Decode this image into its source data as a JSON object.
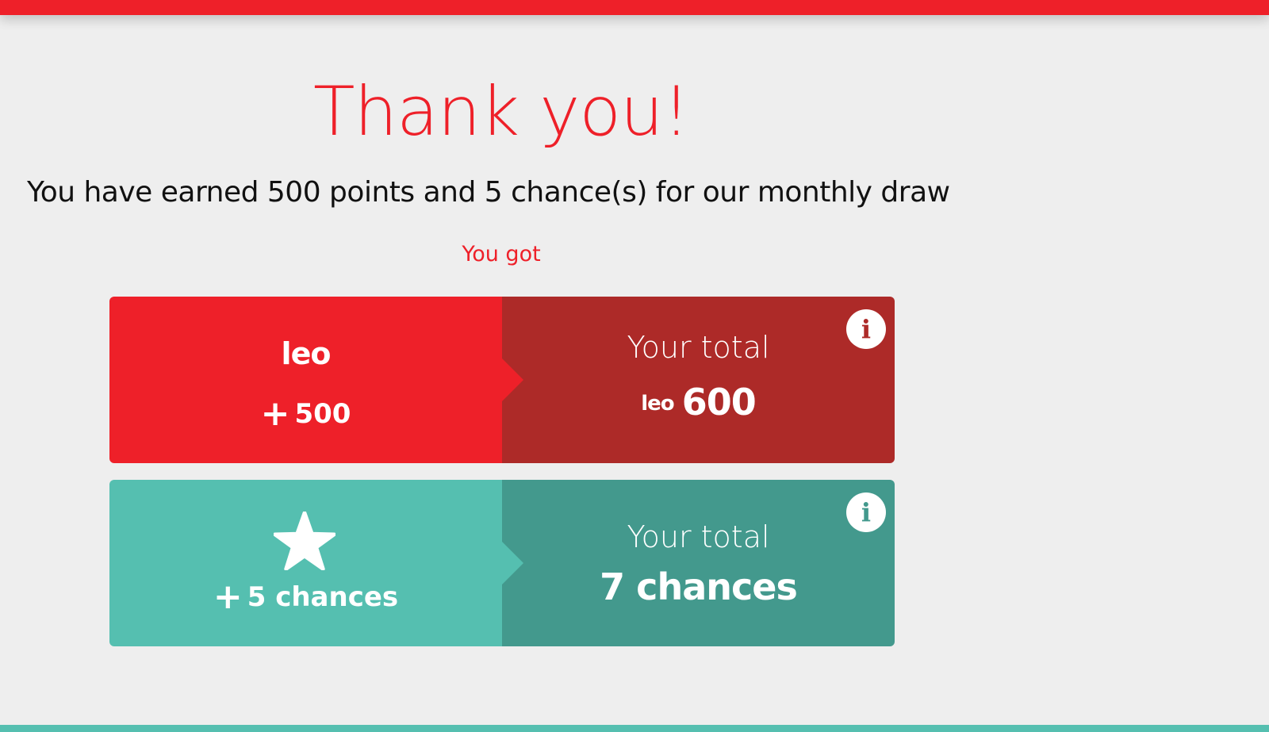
{
  "header": {
    "color": "#ee2029"
  },
  "title": "Thank you!",
  "subtitle": "You have earned 500 points and 5 chance(s) for our monthly draw",
  "you_got_label": "You got",
  "points_card": {
    "brand_logo": "leo",
    "plus_symbol": "+",
    "earned_points": "500",
    "total_label": "Your total",
    "total_logo": "leo",
    "total_points": "600",
    "info_icon": "i",
    "colors": {
      "left": "#ee2029",
      "right": "#ad2a28"
    }
  },
  "chances_card": {
    "icon": "star-icon",
    "plus_symbol": "+",
    "earned_chances": "5 chances",
    "total_label": "Your total",
    "total_chances": "7 chances",
    "info_icon": "i",
    "colors": {
      "left": "#55bfb0",
      "right": "#43998d"
    }
  },
  "footer": {
    "color": "#55bfb0"
  }
}
